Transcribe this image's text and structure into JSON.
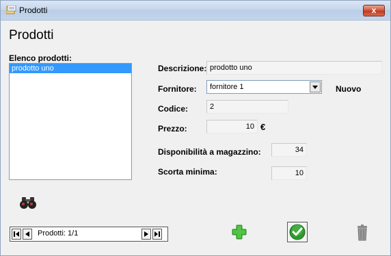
{
  "window": {
    "title": "Prodotti",
    "close_label": "x"
  },
  "heading": "Prodotti",
  "list": {
    "label": "Elenco prodotti:",
    "items": [
      "prodotto uno"
    ]
  },
  "form": {
    "descrizione_label": "Descrizione:",
    "descrizione_value": "prodotto uno",
    "fornitore_label": "Fornitore:",
    "fornitore_value": "fornitore 1",
    "nuovo_label": "Nuovo",
    "codice_label": "Codice:",
    "codice_value": "2",
    "prezzo_label": "Prezzo:",
    "prezzo_value": "10",
    "currency": "€",
    "disponibilita_label": "Disponibilità a magazzino:",
    "disponibilita_value": "34",
    "scorta_label": "Scorta minima:",
    "scorta_value": "10"
  },
  "navigator": {
    "text": "Prodotti: 1/1"
  },
  "icons": [
    "binoculars-icon",
    "add-icon",
    "confirm-icon",
    "trash-icon"
  ],
  "colors": {
    "selection": "#3399ff",
    "add_green": "#3cb030",
    "confirm_green": "#2f9a2f",
    "close_red": "#c13a20"
  }
}
